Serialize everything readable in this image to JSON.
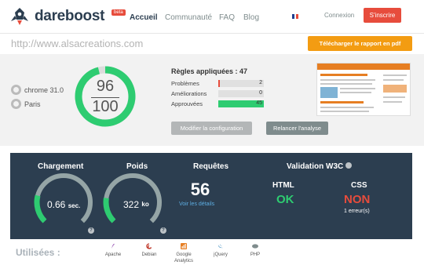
{
  "header": {
    "logo_text": "dareboost",
    "logo_badge": "beta",
    "nav": [
      "Accueil",
      "Communauté",
      "FAQ",
      "Blog"
    ],
    "login": "Connexion",
    "signup": "S'inscrire"
  },
  "urlbar": {
    "url": "http://www.alsacreations.com",
    "pdf_button": "Télécharger le rapport en pdf"
  },
  "summary": {
    "browser": "chrome 31.0",
    "location": "Paris",
    "score": "96",
    "score_max": "100",
    "score_fraction": 0.96,
    "rules_title": "Règles appliquées : 47",
    "rules": [
      {
        "label": "Problèmes",
        "value": "2",
        "fraction": 0.04,
        "color": "#e74c3c"
      },
      {
        "label": "Améliorations",
        "value": "0",
        "fraction": 0.0,
        "color": "#f39c12"
      },
      {
        "label": "Approuvées",
        "value": "45",
        "fraction": 1.0,
        "color": "#2ecc71"
      }
    ],
    "modify_button": "Modifier la configuration",
    "rerun_button": "Relancer l'analyse"
  },
  "metrics": {
    "load": {
      "title": "Chargement",
      "value": "0.66",
      "unit": "sec.",
      "fraction": 0.22,
      "help": "?"
    },
    "weight": {
      "title": "Poids",
      "value": "322",
      "unit": "ko",
      "fraction": 0.2,
      "help": "?"
    },
    "requests": {
      "title": "Requêtes",
      "value": "56",
      "link": "Voir les détails"
    },
    "w3c": {
      "title": "Validation W3C",
      "html_label": "HTML",
      "html_status": "OK",
      "css_label": "CSS",
      "css_status": "NON",
      "css_note": "1 erreur(s)"
    }
  },
  "technologies": {
    "title": "Utilisées :",
    "items": [
      {
        "label": "Apache",
        "icon": "apache-icon",
        "color": "#8e44ad"
      },
      {
        "label": "Debian",
        "icon": "debian-icon",
        "color": "#c0392b"
      },
      {
        "label": "Google Analytics",
        "icon": "google-analytics-icon",
        "color": "#e67e22"
      },
      {
        "label": "jQuery",
        "icon": "jquery-icon",
        "color": "#2980b9"
      },
      {
        "label": "PHP",
        "icon": "php-icon",
        "color": "#7f8c8d"
      }
    ]
  },
  "colors": {
    "accent_green": "#2ecc71",
    "panel_dark": "#2c3e50",
    "signup_red": "#e74c3c",
    "pdf_orange": "#f39c12",
    "link_blue": "#5dade2"
  }
}
